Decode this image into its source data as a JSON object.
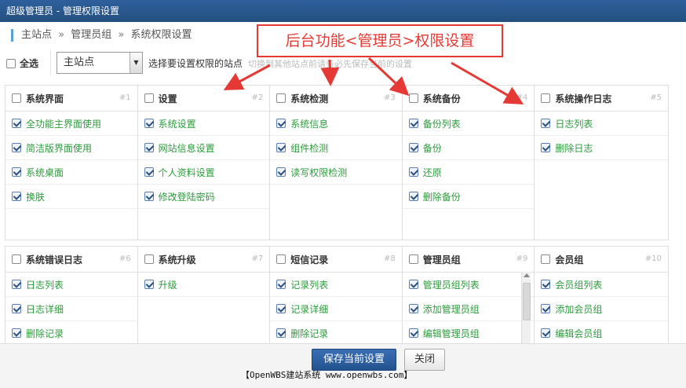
{
  "window": {
    "title": "超级管理员 - 管理权限设置"
  },
  "breadcrumb": [
    "主站点",
    "管理员组",
    "系统权限设置"
  ],
  "breadcrumb_sep": "»",
  "toolbar": {
    "select_all_label": "全选",
    "site_select_value": "主站点",
    "hint": "选择要设置权限的站点",
    "hint_faded": "切换到其他站点前请务必先保存当前的设置"
  },
  "annotation": {
    "text": "后台功能<管理员>权限设置"
  },
  "modules_row1": [
    {
      "title": "系统界面",
      "num": "#1",
      "items": [
        "全功能主界面使用",
        "简洁版界面使用",
        "系统桌面",
        "换肤"
      ]
    },
    {
      "title": "设置",
      "num": "#2",
      "items": [
        "系统设置",
        "网站信息设置",
        "个人资料设置",
        "修改登陆密码"
      ]
    },
    {
      "title": "系统检测",
      "num": "#3",
      "items": [
        "系统信息",
        "组件检测",
        "读写权限检测"
      ]
    },
    {
      "title": "系统备份",
      "num": "#4",
      "items": [
        "备份列表",
        "备份",
        "还原",
        "删除备份"
      ]
    },
    {
      "title": "系统操作日志",
      "num": "#5",
      "items": [
        "日志列表",
        "删除日志"
      ]
    }
  ],
  "modules_row2": [
    {
      "title": "系统错误日志",
      "num": "#6",
      "items": [
        "日志列表",
        "日志详细",
        "删除记录"
      ]
    },
    {
      "title": "系统升级",
      "num": "#7",
      "items": [
        "升级"
      ]
    },
    {
      "title": "短信记录",
      "num": "#8",
      "items": [
        "记录列表",
        "记录详细",
        "删除记录"
      ]
    },
    {
      "title": "管理员组",
      "num": "#9",
      "items": [
        "管理员组列表",
        "添加管理员组",
        "编辑管理员组"
      ]
    },
    {
      "title": "会员组",
      "num": "#10",
      "items": [
        "会员组列表",
        "添加会员组",
        "编辑会员组"
      ]
    }
  ],
  "footer": {
    "save_label": "保存当前设置",
    "close_label": "关闭",
    "watermark": "【OpenWBS建站系统 www.openwbs.com】"
  },
  "colors": {
    "titlebar": "#2a5a93",
    "item_text": "#2b9b3b",
    "annotation": "#e53935",
    "save_button": "#2d62a6"
  }
}
